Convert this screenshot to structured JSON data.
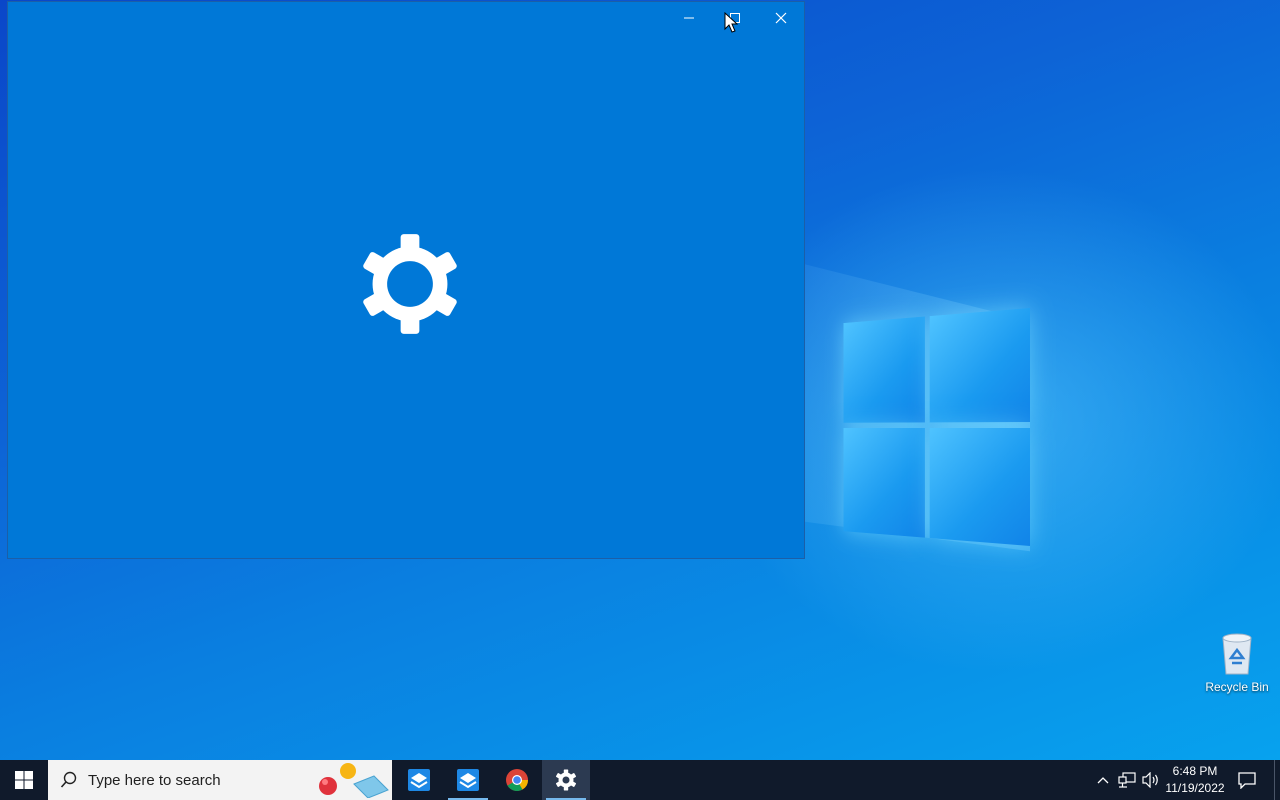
{
  "desktop": {
    "icons": [
      {
        "label": "Recycle Bin",
        "icon": "recycle-bin-icon"
      }
    ]
  },
  "window": {
    "title": "",
    "background_color": "#0078d7",
    "splash_icon": "gear-icon",
    "caption_buttons": [
      "minimize",
      "maximize",
      "close"
    ]
  },
  "taskbar": {
    "start_icon": "windows-logo-icon",
    "search": {
      "placeholder": "Type here to search",
      "icon": "search-icon"
    },
    "apps": [
      {
        "name": "app-1",
        "icon": "box-app-icon",
        "active": false
      },
      {
        "name": "app-2",
        "icon": "box-app-icon",
        "active": true
      },
      {
        "name": "chrome",
        "icon": "chrome-icon",
        "active": false
      },
      {
        "name": "settings",
        "icon": "gear-icon",
        "active": true
      }
    ],
    "tray": {
      "icons": [
        "chevron-up-icon",
        "network-icon",
        "volume-icon"
      ],
      "time": "6:48 PM",
      "date": "11/19/2022",
      "notification_icon": "notification-icon"
    }
  }
}
